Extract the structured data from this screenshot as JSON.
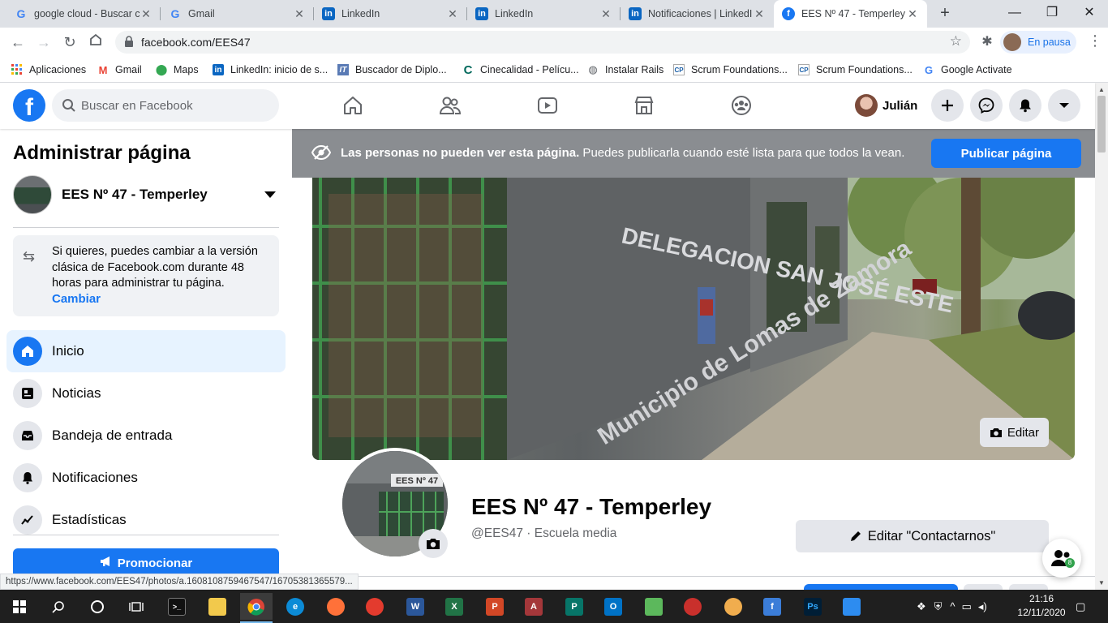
{
  "browser": {
    "tabs": [
      {
        "title": "google cloud - Buscar c",
        "icon": "google-icon"
      },
      {
        "title": "Gmail",
        "icon": "google-icon"
      },
      {
        "title": "LinkedIn",
        "icon": "linkedin-icon"
      },
      {
        "title": "LinkedIn",
        "icon": "linkedin-icon"
      },
      {
        "title": "Notificaciones | LinkedI",
        "icon": "linkedin-icon"
      },
      {
        "title": "EES Nº 47 - Temperley |",
        "icon": "facebook-icon"
      }
    ],
    "url": "facebook.com/EES47",
    "profile_status": "En pausa",
    "bookmarks": [
      {
        "label": "Aplicaciones",
        "icon": "apps-grid-icon"
      },
      {
        "label": "Gmail",
        "icon": "gmail-icon"
      },
      {
        "label": "Maps",
        "icon": "maps-pin-icon"
      },
      {
        "label": "LinkedIn: inicio de s...",
        "icon": "linkedin-icon"
      },
      {
        "label": "Buscador de Diplo...",
        "icon": "it-icon"
      },
      {
        "label": "Cinecalidad - Pelícu...",
        "icon": "cinecalidad-icon"
      },
      {
        "label": "Instalar Rails",
        "icon": "globe-icon"
      },
      {
        "label": "Scrum Foundations...",
        "icon": "cp-icon"
      },
      {
        "label": "Scrum Foundations...",
        "icon": "cp-icon"
      },
      {
        "label": "Google Activate",
        "icon": "google-icon"
      }
    ],
    "status_url": "https://www.facebook.com/EES47/photos/a.1608108759467547/16705381365579..."
  },
  "facebook": {
    "search_placeholder": "Buscar en Facebook",
    "user_name": "Julián",
    "sidebar": {
      "title": "Administrar página",
      "page_name": "EES Nº 47 - Temperley",
      "notice_text": "Si quieres, puedes cambiar a la versión clásica de Facebook.com durante 48 horas para administrar tu página.",
      "notice_link": "Cambiar",
      "items": [
        {
          "label": "Inicio",
          "icon": "home-icon"
        },
        {
          "label": "Noticias",
          "icon": "news-icon"
        },
        {
          "label": "Bandeja de entrada",
          "icon": "inbox-icon"
        },
        {
          "label": "Notificaciones",
          "icon": "bell-icon"
        },
        {
          "label": "Estadísticas",
          "icon": "stats-icon"
        }
      ],
      "promote_label": "Promocionar"
    },
    "banner": {
      "bold": "Las personas no pueden ver esta página.",
      "text": " Puedes publicarla cuando esté lista para que todos la vean.",
      "button": "Publicar página"
    },
    "cover": {
      "edit_label": "Editar",
      "sign_line1": "DELEGACION SAN JOSÉ ESTE",
      "sign_line2": "Municipio de Lomas de Zamora"
    },
    "profile": {
      "plaque": "EES Nº 47",
      "name": "EES Nº 47 - Temperley",
      "subtitle": "@EES47 · Escuela media",
      "contact_button": "Editar \"Contactarnos\"",
      "friends_badge": "8"
    }
  },
  "taskbar": {
    "time": "21:16",
    "date": "12/11/2020"
  }
}
